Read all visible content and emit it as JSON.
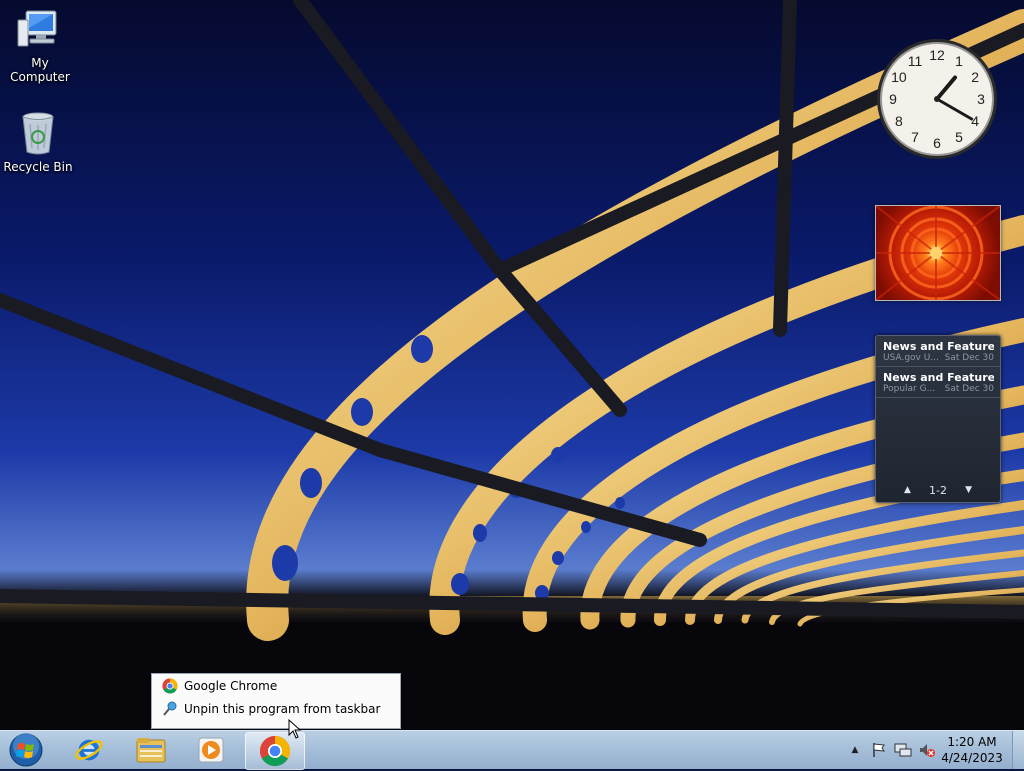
{
  "desktop": {
    "icons": [
      {
        "label": "My Computer",
        "icon": "computer-icon"
      },
      {
        "label": "Recycle Bin",
        "icon": "recycle-bin-icon"
      }
    ]
  },
  "gadgets": {
    "clock": {
      "hour": 1,
      "minute": 20,
      "numerals": [
        "12",
        "1",
        "2",
        "3",
        "4",
        "5",
        "6",
        "7",
        "8",
        "9",
        "10",
        "11"
      ]
    },
    "feed": {
      "items": [
        {
          "title": "News and Features f...",
          "source": "USA.gov U...",
          "date": "Sat Dec 30"
        },
        {
          "title": "News and Features f...",
          "source": "Popular G...",
          "date": "Sat Dec 30"
        }
      ],
      "page": "1-2"
    }
  },
  "jumplist": {
    "items": [
      {
        "label": "Google Chrome",
        "icon": "chrome-icon"
      },
      {
        "label": "Unpin this program from taskbar",
        "icon": "unpin-icon"
      }
    ]
  },
  "taskbar": {
    "pinned": [
      {
        "name": "internet-explorer",
        "icon": "ie-icon"
      },
      {
        "name": "windows-explorer",
        "icon": "folder-icon"
      },
      {
        "name": "media-player",
        "icon": "media-player-icon"
      },
      {
        "name": "google-chrome",
        "icon": "chrome-icon",
        "active": true
      }
    ],
    "tray": {
      "time": "1:20 AM",
      "date": "4/24/2023",
      "icons": [
        "show-hidden-icon",
        "action-center-flag-icon",
        "network-icon",
        "volume-muted-icon"
      ]
    }
  },
  "colors": {
    "taskbar": "#a6bfd9",
    "chrome_red": "#db4437",
    "chrome_green": "#0f9d58",
    "chrome_yellow": "#f4b400",
    "chrome_blue": "#4285f4"
  }
}
